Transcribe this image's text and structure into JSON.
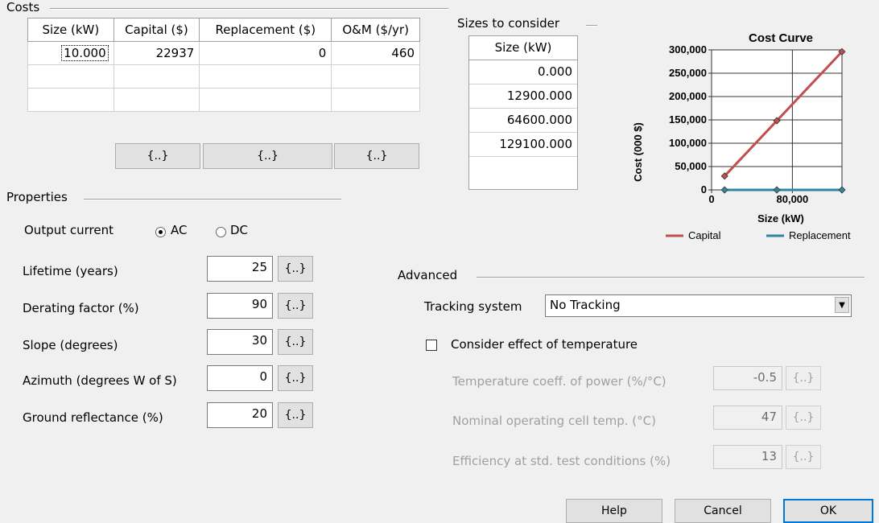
{
  "costs": {
    "title": "Costs",
    "headers": [
      "Size (kW)",
      "Capital ($)",
      "Replacement ($)",
      "O&M ($/yr)"
    ],
    "rows": [
      [
        "10.000",
        "22937",
        "0",
        "460"
      ],
      [
        "",
        "",
        "",
        ""
      ]
    ],
    "button_labels": [
      "{..}",
      "{..}",
      "{..}"
    ]
  },
  "sizes": {
    "title": "Sizes to consider",
    "header": "Size (kW)",
    "values": [
      "0.000",
      "12900.000",
      "64600.000",
      "129100.000",
      ""
    ]
  },
  "chart_data": {
    "type": "line",
    "title": "Cost Curve",
    "xlabel": "Size (kW)",
    "ylabel": "Cost (000 $)",
    "xlim": [
      0,
      129100
    ],
    "ylim": [
      0,
      300000
    ],
    "x_ticks": [
      "0",
      "80,000"
    ],
    "y_ticks": [
      "0",
      "50,000",
      "100,000",
      "150,000",
      "200,000",
      "250,000",
      "300,000"
    ],
    "series": [
      {
        "name": "Capital",
        "color": "#c0504d",
        "x": [
          12900,
          64600,
          129100
        ],
        "y": [
          29590,
          148173,
          296116
        ]
      },
      {
        "name": "Replacement",
        "color": "#31859c",
        "x": [
          12900,
          64600,
          129100
        ],
        "y": [
          0,
          0,
          0
        ]
      }
    ]
  },
  "properties": {
    "title": "Properties",
    "output_current_label": "Output current",
    "ac_label": "AC",
    "dc_label": "DC",
    "output_current_selected": "AC",
    "fields": [
      {
        "label": "Lifetime (years)",
        "value": "25",
        "button": "{..}"
      },
      {
        "label": "Derating factor (%)",
        "value": "90",
        "button": "{..}"
      },
      {
        "label": "Slope (degrees)",
        "value": "30",
        "button": "{..}"
      },
      {
        "label": "Azimuth (degrees W of S)",
        "value": "0",
        "button": "{..}"
      },
      {
        "label": "Ground reflectance (%)",
        "value": "20",
        "button": "{..}"
      }
    ]
  },
  "advanced": {
    "title": "Advanced",
    "tracking_label": "Tracking system",
    "tracking_value": "No Tracking",
    "temperature_checkbox_label": "Consider effect of temperature",
    "temperature_checked": false,
    "temp_fields": [
      {
        "label": "Temperature coeff. of power (%/°C)",
        "value": "-0.5",
        "button": "{..}"
      },
      {
        "label": "Nominal operating cell temp. (°C)",
        "value": "47",
        "button": "{..}"
      },
      {
        "label": "Efficiency at std. test conditions (%)",
        "value": "13",
        "button": "{..}"
      }
    ]
  },
  "footer": {
    "help": "Help",
    "cancel": "Cancel",
    "ok": "OK"
  }
}
